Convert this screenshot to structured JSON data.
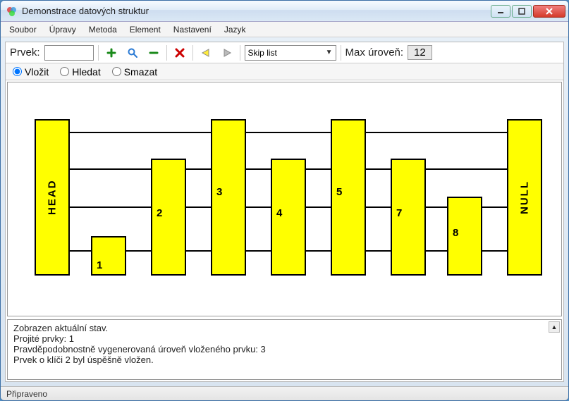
{
  "window": {
    "title": "Demonstrace datových struktur"
  },
  "menu": {
    "items": [
      "Soubor",
      "Úpravy",
      "Metoda",
      "Element",
      "Nastavení",
      "Jazyk"
    ]
  },
  "toolbar": {
    "prvek_label": "Prvek:",
    "prvek_value": "",
    "max_level_label": "Max úroveň:",
    "max_level_value": "12",
    "combo_selected": "Skip list"
  },
  "radios": {
    "vlozit": "Vložit",
    "hledat": "Hledat",
    "smazat": "Smazat",
    "selected": "vlozit"
  },
  "skiplist": {
    "head_label": "HEAD",
    "null_label": "NULL",
    "nodes": [
      "1",
      "2",
      "3",
      "4",
      "5",
      "7",
      "8"
    ]
  },
  "log": {
    "lines": [
      "Zobrazen aktuální stav.",
      "Projité prvky: 1",
      "Pravděpodobnostně vygenerovaná úroveň vloženého prvku: 3",
      "Prvek o klíči 2 byl úspěšně vložen."
    ]
  },
  "status": {
    "text": "Připraveno"
  }
}
